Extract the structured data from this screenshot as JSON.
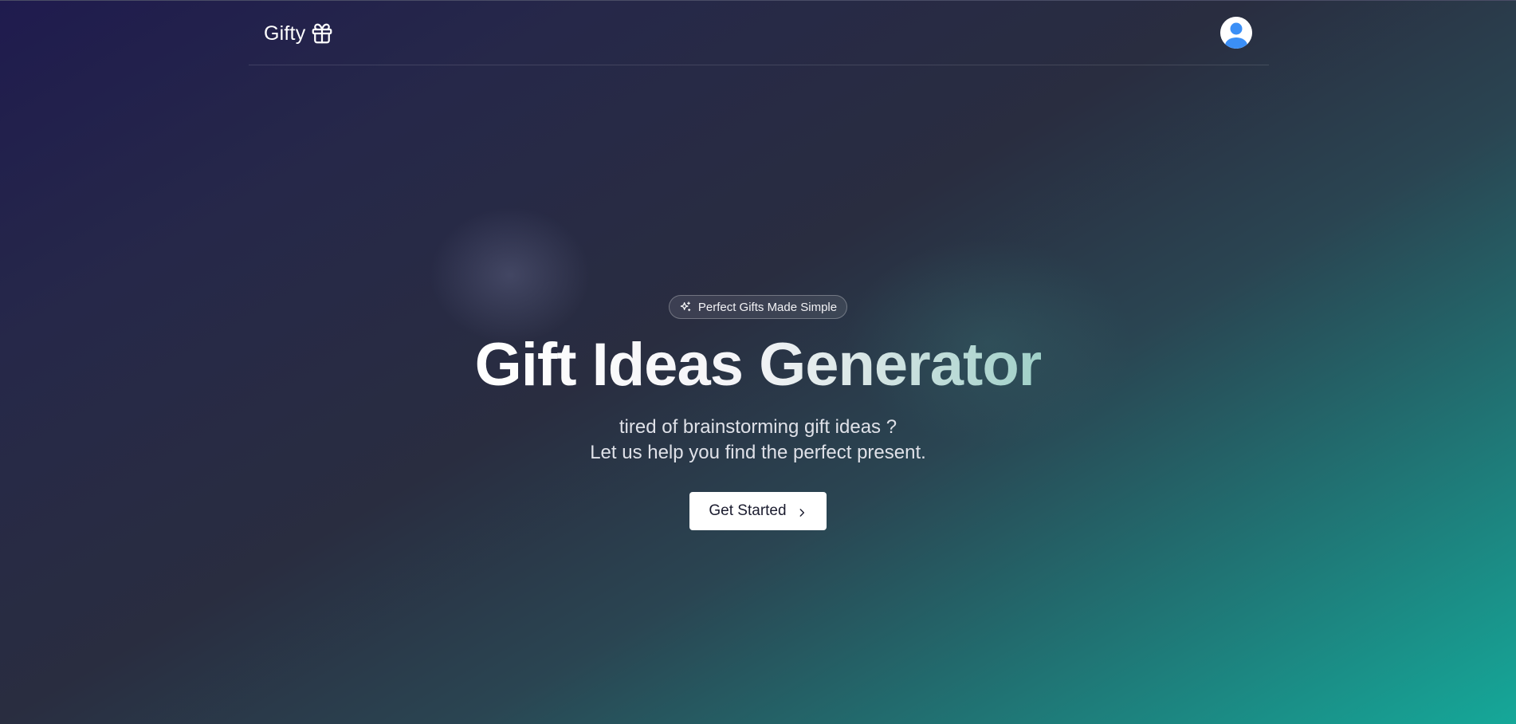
{
  "header": {
    "brand_name": "Gifty",
    "brand_icon": "gift-icon",
    "avatar_icon": "user-avatar-icon"
  },
  "hero": {
    "badge_icon": "sparkle-icon",
    "badge_label": "Perfect Gifts Made Simple",
    "headline": "Gift Ideas Generator",
    "subtitle_line1": "tired of brainstorming gift ideas ?",
    "subtitle_line2": "Let us help you find the perfect present.",
    "cta_label": "Get Started",
    "cta_icon": "chevron-right-icon"
  },
  "colors": {
    "background_start": "#1f1b4e",
    "background_end": "#15a899",
    "avatar_blue": "#3b8ff6",
    "button_background": "#ffffff",
    "button_text": "#1a1b2e"
  }
}
